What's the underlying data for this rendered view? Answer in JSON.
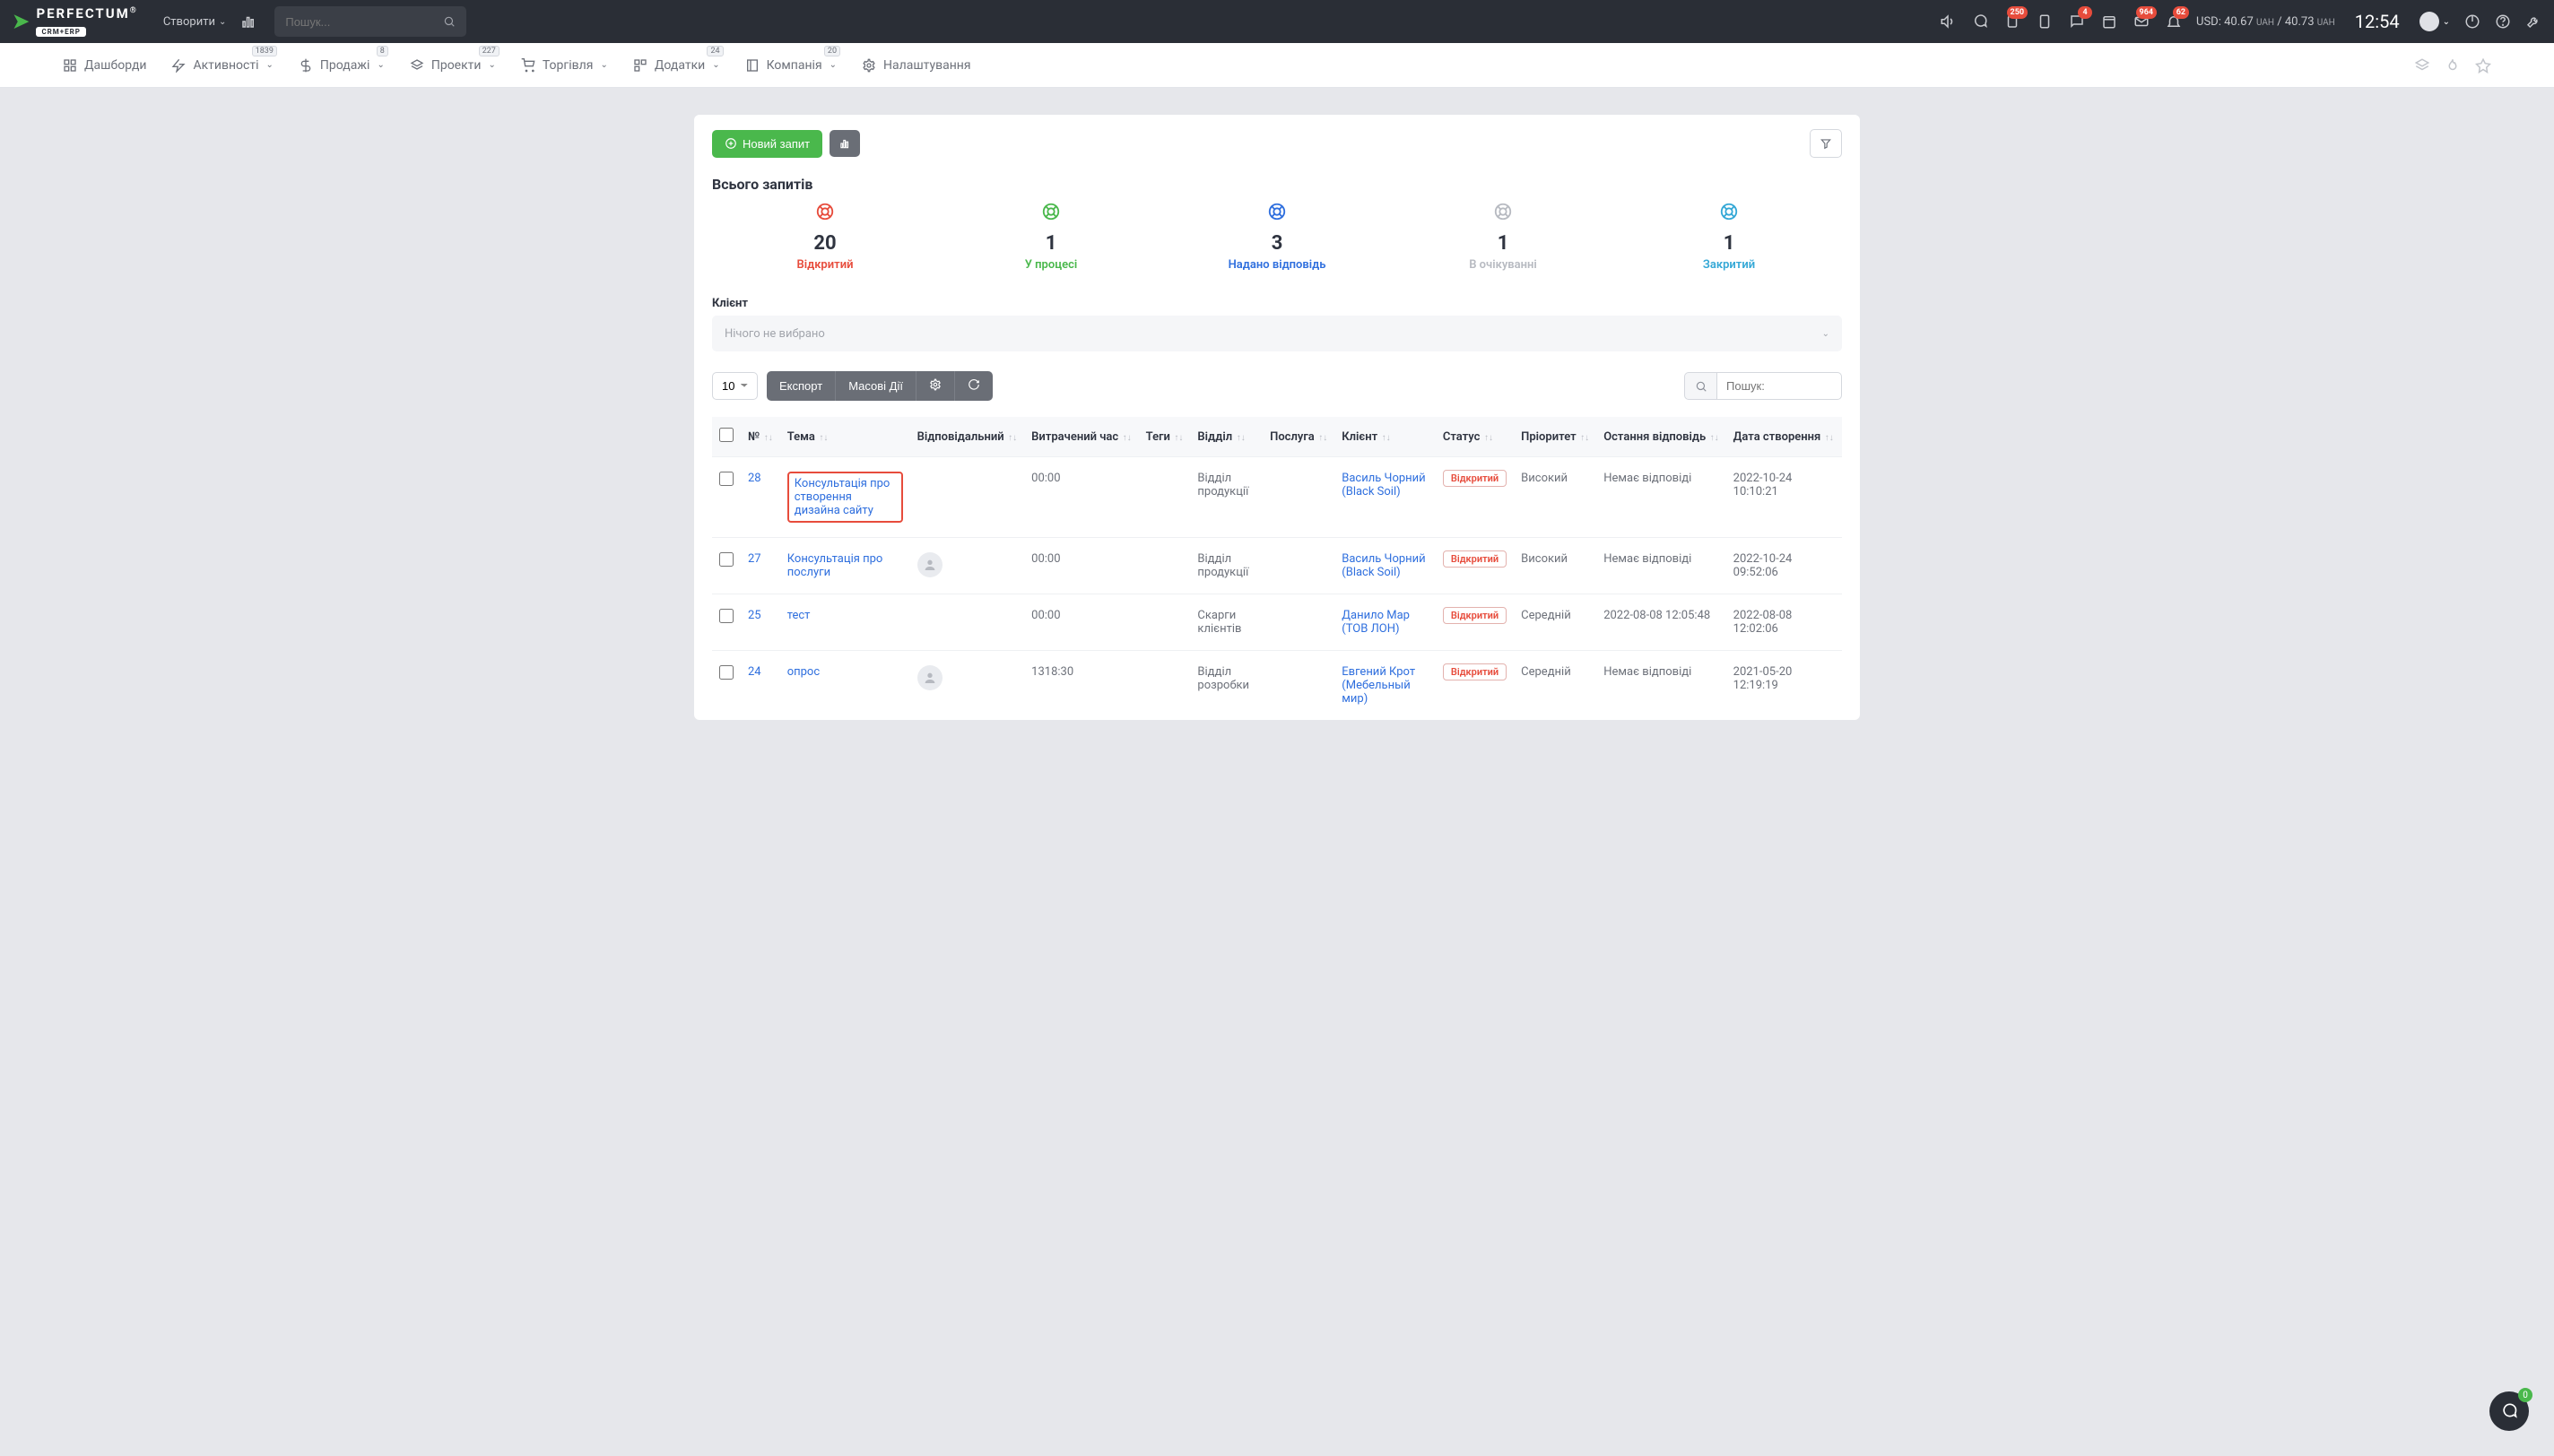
{
  "topbar": {
    "logo_name": "PERFECTUM",
    "logo_sub": "CRM+ERP",
    "create_label": "Створити",
    "search_placeholder": "Пошук...",
    "rate_currency": "USD:",
    "rate1": "40.67",
    "rate_unit": "UAH",
    "rate_sep": " / ",
    "rate2": "40.73",
    "clock": "12:54",
    "badges": {
      "clipboard": "250",
      "chat": "4",
      "mail": "964",
      "bell": "62"
    }
  },
  "subnav": {
    "items": [
      {
        "label": "Дашборди",
        "badge": ""
      },
      {
        "label": "Активності",
        "badge": "1839"
      },
      {
        "label": "Продажі",
        "badge": "8"
      },
      {
        "label": "Проекти",
        "badge": "227"
      },
      {
        "label": "Торгівля",
        "badge": ""
      },
      {
        "label": "Додатки",
        "badge": "24"
      },
      {
        "label": "Компанія",
        "badge": "20"
      },
      {
        "label": "Налаштування",
        "badge": ""
      }
    ]
  },
  "toolbar": {
    "new_request": "Новий запит"
  },
  "summary": {
    "title": "Всього запитів",
    "stats": [
      {
        "num": "20",
        "label": "Відкритий",
        "cls": "c-red"
      },
      {
        "num": "1",
        "label": "У процесі",
        "cls": "c-green"
      },
      {
        "num": "3",
        "label": "Надано відповідь",
        "cls": "c-blue"
      },
      {
        "num": "1",
        "label": "В очікуванні",
        "cls": "c-grey"
      },
      {
        "num": "1",
        "label": "Закритий",
        "cls": "c-cyan"
      }
    ]
  },
  "filter": {
    "label": "Клієнт",
    "placeholder": "Нічого не вибрано"
  },
  "list": {
    "page_size": "10",
    "export": "Експорт",
    "bulk": "Масові Дії",
    "search_placeholder": "Пошук:",
    "columns": [
      "№",
      "Тема",
      "Відповідальний",
      "Витрачений час",
      "Теги",
      "Відділ",
      "Послуга",
      "Клієнт",
      "Статус",
      "Пріоритет",
      "Остання відповідь",
      "Дата створення"
    ],
    "rows": [
      {
        "num": "28",
        "topic": "Консультація про створення дизайна сайту",
        "hl": true,
        "responsible": "",
        "time": "00:00",
        "tags": "",
        "dept": "Відділ продукції",
        "service": "",
        "client": "Василь Чорний (Black Soil)",
        "status": "Відкритий",
        "priority": "Високий",
        "last": "Немає відповіді",
        "created": "2022-10-24 10:10:21"
      },
      {
        "num": "27",
        "topic": "Консультація про послуги",
        "hl": false,
        "responsible": "avatar",
        "time": "00:00",
        "tags": "",
        "dept": "Відділ продукції",
        "service": "",
        "client": "Василь Чорний (Black Soil)",
        "status": "Відкритий",
        "priority": "Високий",
        "last": "Немає відповіді",
        "created": "2022-10-24 09:52:06"
      },
      {
        "num": "25",
        "topic": "тест",
        "hl": false,
        "responsible": "",
        "time": "00:00",
        "tags": "",
        "dept": "Скарги клієнтів",
        "service": "",
        "client": "Данило Мар (ТОВ ЛОН)",
        "status": "Відкритий",
        "priority": "Середній",
        "last": "2022-08-08 12:05:48",
        "created": "2022-08-08 12:02:06"
      },
      {
        "num": "24",
        "topic": "опрос",
        "hl": false,
        "responsible": "avatar",
        "time": "1318:30",
        "tags": "",
        "dept": "Відділ розробки",
        "service": "",
        "client": "Евгений Крот (Мебельный мир)",
        "status": "Відкритий",
        "priority": "Середній",
        "last": "Немає відповіді",
        "created": "2021-05-20 12:19:19"
      }
    ]
  },
  "fab": {
    "badge": "0"
  }
}
